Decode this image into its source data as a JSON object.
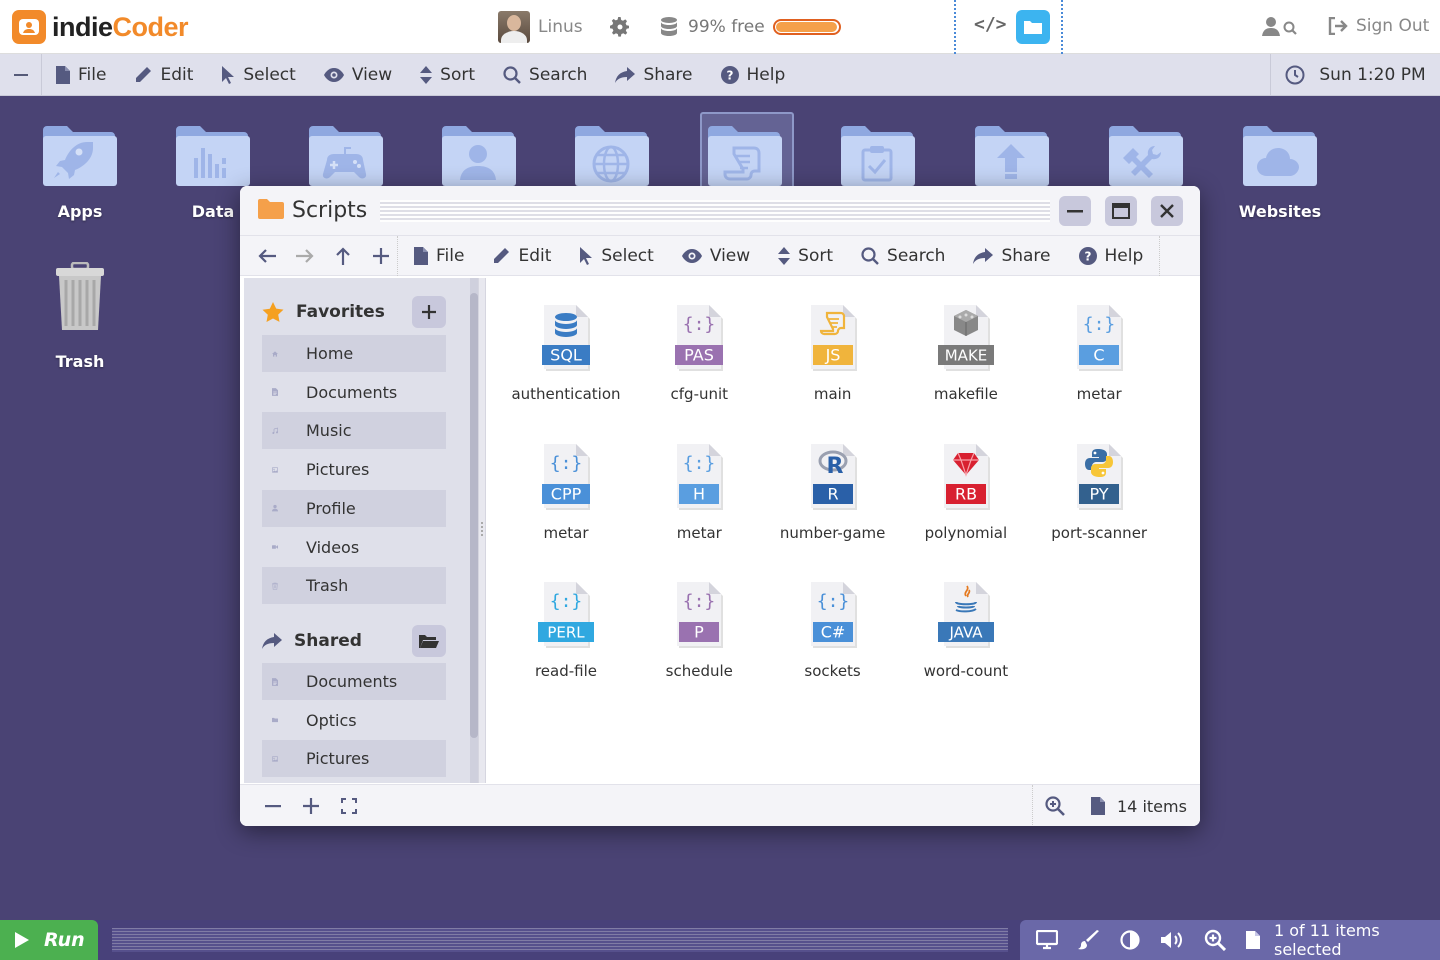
{
  "app": {
    "logo_a": "indie",
    "logo_b": "Coder"
  },
  "header": {
    "user_name": "Linus",
    "storage_text": "99% free",
    "storage_used": 0.99,
    "sign_out": "Sign Out"
  },
  "menubar": {
    "items": [
      "File",
      "Edit",
      "Select",
      "View",
      "Sort",
      "Search",
      "Share",
      "Help"
    ],
    "clock": "Sun 1:20 PM"
  },
  "desktop": {
    "icons": [
      {
        "label": "Apps",
        "icon": "rocket-icon"
      },
      {
        "label": "Data",
        "icon": "chart-icon"
      },
      {
        "label": "",
        "icon": "gamepad-icon"
      },
      {
        "label": "",
        "icon": "user-icon"
      },
      {
        "label": "",
        "icon": "globe-icon"
      },
      {
        "label": "",
        "icon": "scroll-icon"
      },
      {
        "label": "",
        "icon": "clipboard-check-icon"
      },
      {
        "label": "",
        "icon": "upload-icon"
      },
      {
        "label": "",
        "icon": "tools-icon"
      },
      {
        "label": "Websites",
        "icon": "cloud-icon"
      }
    ],
    "trash_label": "Trash"
  },
  "window": {
    "title": "Scripts",
    "menu": [
      "File",
      "Edit",
      "Select",
      "View",
      "Sort",
      "Search",
      "Share",
      "Help"
    ],
    "sidebar": {
      "favorites_label": "Favorites",
      "favorites": [
        {
          "label": "Home",
          "icon": "home-icon"
        },
        {
          "label": "Documents",
          "icon": "document-icon"
        },
        {
          "label": "Music",
          "icon": "music-icon"
        },
        {
          "label": "Pictures",
          "icon": "image-icon"
        },
        {
          "label": "Profile",
          "icon": "user-icon"
        },
        {
          "label": "Videos",
          "icon": "video-icon"
        },
        {
          "label": "Trash",
          "icon": "trash-icon"
        }
      ],
      "shared_label": "Shared",
      "shared": [
        {
          "label": "Documents",
          "icon": "document-icon"
        },
        {
          "label": "Optics",
          "icon": "folder-icon"
        },
        {
          "label": "Pictures",
          "icon": "image-icon"
        }
      ]
    },
    "files": [
      {
        "name": "authentication",
        "ext": "SQL",
        "color": "#3a7cc4",
        "glyph": "db"
      },
      {
        "name": "cfg-unit",
        "ext": "PAS",
        "color": "#9a72b0",
        "glyph": "braces"
      },
      {
        "name": "main",
        "ext": "JS",
        "color": "#f0b43c",
        "glyph": "scroll"
      },
      {
        "name": "makefile",
        "ext": "MAKE",
        "color": "#7a7a7a",
        "glyph": "cube"
      },
      {
        "name": "metar",
        "ext": "C",
        "color": "#5a9ee0",
        "glyph": "braces"
      },
      {
        "name": "metar",
        "ext": "CPP",
        "color": "#4a90d8",
        "glyph": "braces"
      },
      {
        "name": "metar",
        "ext": "H",
        "color": "#5a9ee0",
        "glyph": "braces"
      },
      {
        "name": "number-game",
        "ext": "R",
        "color": "#2a60a8",
        "glyph": "r"
      },
      {
        "name": "polynomial",
        "ext": "RB",
        "color": "#d82030",
        "glyph": "ruby"
      },
      {
        "name": "port-scanner",
        "ext": "PY",
        "color": "#33618e",
        "glyph": "python"
      },
      {
        "name": "read-file",
        "ext": "PERL",
        "color": "#30a8e0",
        "glyph": "braces"
      },
      {
        "name": "schedule",
        "ext": "P",
        "color": "#9a72b0",
        "glyph": "braces"
      },
      {
        "name": "sockets",
        "ext": "C#",
        "color": "#4a90d8",
        "glyph": "braces"
      },
      {
        "name": "word-count",
        "ext": "JAVA",
        "color": "#3a78b8",
        "glyph": "java"
      }
    ],
    "status": "14 items"
  },
  "taskbar": {
    "run_label": "Run",
    "selection_text": "1 of 11 items selected"
  }
}
